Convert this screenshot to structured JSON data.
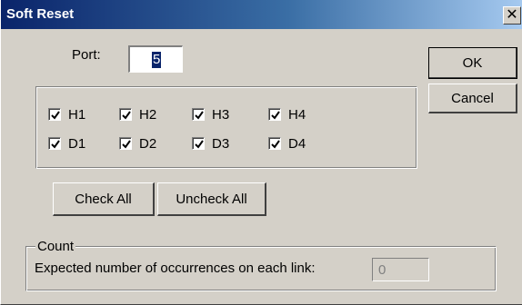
{
  "window": {
    "title": "Soft Reset",
    "close_glyph": "✕"
  },
  "port": {
    "label": "Port:",
    "value": "5"
  },
  "buttons": {
    "ok": "OK",
    "cancel": "Cancel",
    "check_all": "Check All",
    "uncheck_all": "Uncheck All"
  },
  "checkboxes": [
    {
      "label": "H1",
      "checked": true
    },
    {
      "label": "H2",
      "checked": true
    },
    {
      "label": "H3",
      "checked": true
    },
    {
      "label": "H4",
      "checked": true
    },
    {
      "label": "D1",
      "checked": true
    },
    {
      "label": "D2",
      "checked": true
    },
    {
      "label": "D3",
      "checked": true
    },
    {
      "label": "D4",
      "checked": true
    }
  ],
  "count": {
    "legend": "Count",
    "label": "Expected number of occurrences on each link:",
    "value": "0"
  },
  "icons": {
    "close": "close-icon",
    "check": "checkmark-icon"
  },
  "colors": {
    "title_start": "#0a246a",
    "title_end": "#a6caf0",
    "face": "#d4d0c8"
  }
}
